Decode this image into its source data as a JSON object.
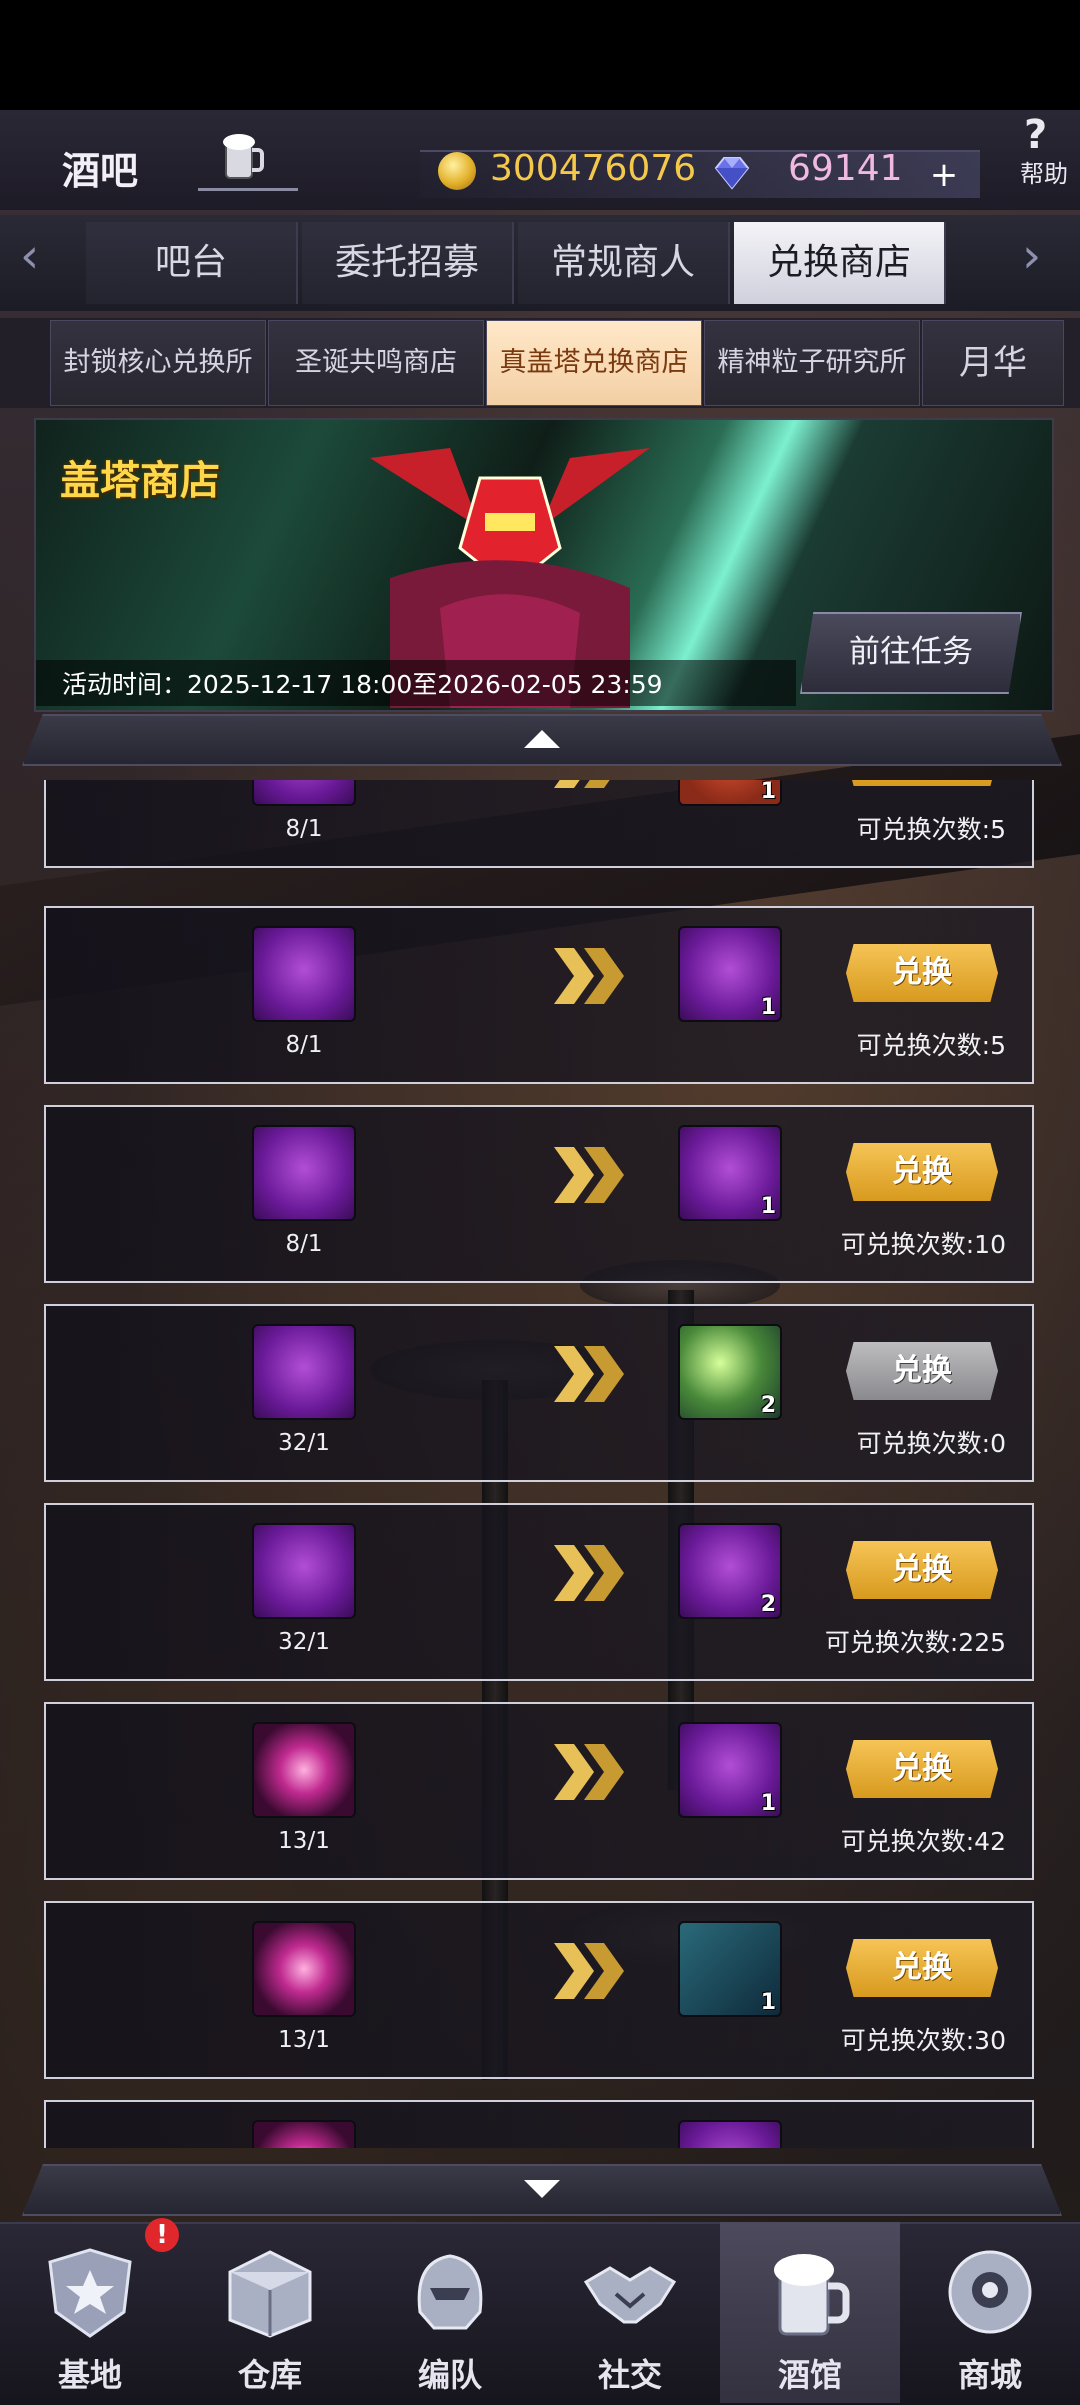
{
  "header": {
    "title": "酒吧",
    "coins": "300476076",
    "gems": "69141",
    "plus": "+",
    "help_symbol": "?",
    "help_label": "帮助"
  },
  "tabs": [
    {
      "label": "吧台",
      "active": false
    },
    {
      "label": "委托招募",
      "active": false
    },
    {
      "label": "常规商人",
      "active": false
    },
    {
      "label": "兑换商店",
      "active": true
    }
  ],
  "subtabs": [
    {
      "label": "封锁核心兑换所",
      "active": false
    },
    {
      "label": "圣诞共鸣商店",
      "active": false
    },
    {
      "label": "真盖塔兑换商店",
      "active": true
    },
    {
      "label": "精神粒子研究所",
      "active": false
    },
    {
      "label": "月华",
      "active": false
    }
  ],
  "banner": {
    "title": "盖塔商店",
    "goto_button": "前往任务",
    "time_label": "活动时间：2025-12-17 18:00至2026-02-05 23:59"
  },
  "exchange": {
    "button_label": "兑换",
    "rows": [
      {
        "cost_icon": "getter-part-icon",
        "ratio": "8/1",
        "reward_icon": "document-icon",
        "reward_qty": "1",
        "remaining": "可兑换次数:5",
        "enabled": true
      },
      {
        "cost_icon": "getter-part-icon",
        "ratio": "8/1",
        "reward_icon": "axe-icon",
        "reward_qty": "1",
        "remaining": "可兑换次数:5",
        "enabled": true
      },
      {
        "cost_icon": "getter-part-icon",
        "ratio": "8/1",
        "reward_icon": "green-gem-pendant-icon",
        "reward_qty": "1",
        "remaining": "可兑换次数:10",
        "enabled": true
      },
      {
        "cost_icon": "weapon-parts-icon",
        "ratio": "32/1",
        "reward_icon": "green-beam-icon",
        "reward_qty": "2",
        "remaining": "可兑换次数:0",
        "enabled": false
      },
      {
        "cost_icon": "weapon-parts-icon",
        "ratio": "32/1",
        "reward_icon": "crystal-shard-icon",
        "reward_qty": "2",
        "remaining": "可兑换次数:225",
        "enabled": true
      },
      {
        "cost_icon": "core-orb-icon",
        "ratio": "13/1",
        "reward_icon": "green-capsule-icon",
        "reward_qty": "1",
        "remaining": "可兑换次数:42",
        "enabled": true
      },
      {
        "cost_icon": "core-orb-icon",
        "ratio": "13/1",
        "reward_icon": "blueprint-icon",
        "reward_qty": "1",
        "remaining": "可兑换次数:30",
        "enabled": true
      }
    ]
  },
  "nav": [
    {
      "label": "基地",
      "icon": "star-emblem-icon",
      "active": false,
      "alert": "!"
    },
    {
      "label": "仓库",
      "icon": "warehouse-icon",
      "active": false
    },
    {
      "label": "编队",
      "icon": "helmet-icon",
      "active": false
    },
    {
      "label": "社交",
      "icon": "handshake-icon",
      "active": false
    },
    {
      "label": "酒馆",
      "icon": "beer-mug-icon",
      "active": true
    },
    {
      "label": "商城",
      "icon": "robot-orb-icon",
      "active": false
    }
  ],
  "colors": {
    "gold_button": "#f6c456",
    "disabled_button": "#bdbdc0",
    "active_subtab": "#ffe8c8",
    "coin_text": "#f4c84a",
    "gem_text": "#efb9e0"
  }
}
